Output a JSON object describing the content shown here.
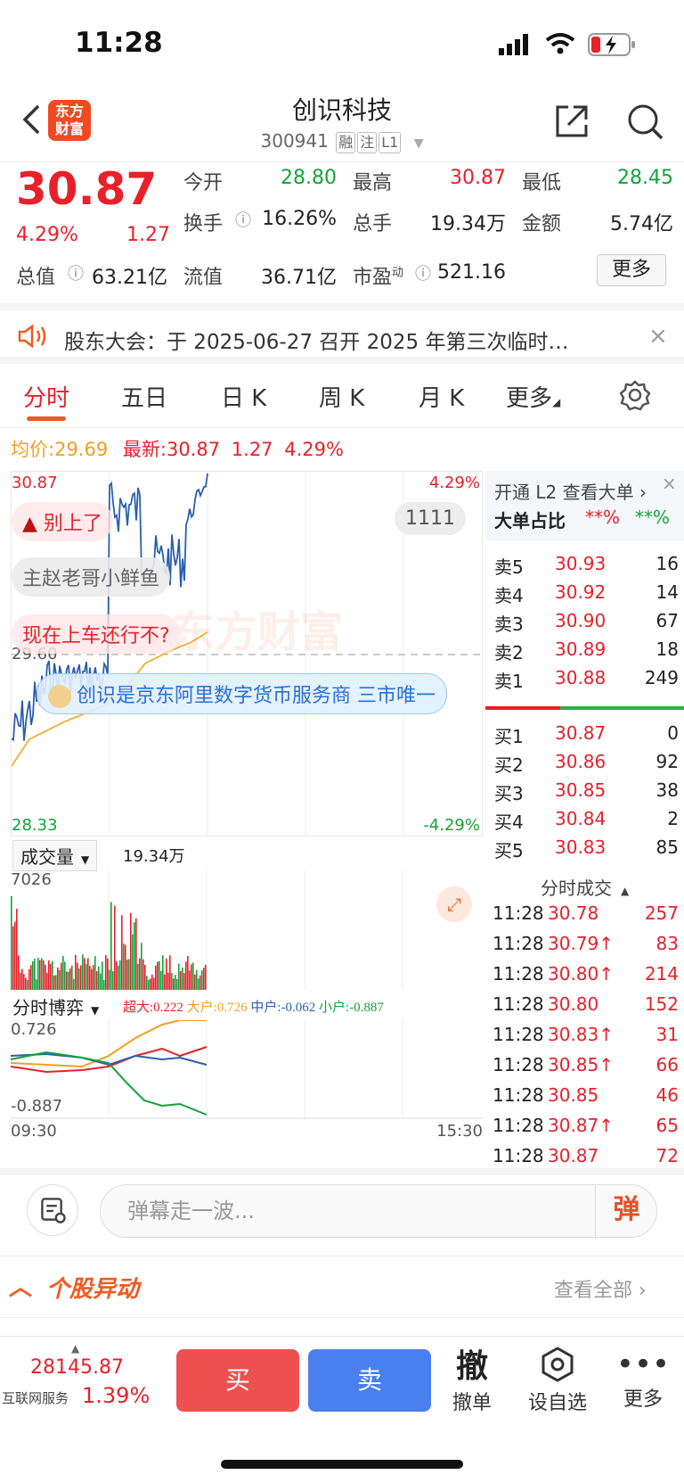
{
  "status_bar": {
    "time": "11:28"
  },
  "header": {
    "logo_line1": "东方",
    "logo_line2": "财富",
    "title": "创识科技",
    "code": "300941",
    "tags": [
      "融",
      "注",
      "L1"
    ]
  },
  "quote": {
    "price": "30.87",
    "change_pct": "4.29%",
    "change": "1.27",
    "fields": [
      {
        "label": "今开",
        "value": "28.80",
        "color": "#12a33a"
      },
      {
        "label": "最高",
        "value": "30.87",
        "color": "#e8202a"
      },
      {
        "label": "最低",
        "value": "28.45",
        "color": "#12a33a"
      },
      {
        "label": "换手",
        "value": "16.26%",
        "color": "#222222"
      },
      {
        "label": "总手",
        "value": "19.34万",
        "color": "#222222"
      },
      {
        "label": "金额",
        "value": "5.74亿",
        "color": "#222222"
      },
      {
        "label": "总值",
        "value": "63.21亿",
        "color": "#222222"
      },
      {
        "label": "流值",
        "value": "36.71亿",
        "color": "#222222"
      },
      {
        "label": "市盈",
        "sup": "动",
        "value": "521.16",
        "color": "#222222"
      }
    ],
    "more": "更多"
  },
  "notice": {
    "text": "股东大会：于 2025-06-27 召开 2025 年第三次临时…"
  },
  "tabs": [
    "分时",
    "五日",
    "日 K",
    "周 K",
    "月 K",
    "更多"
  ],
  "avg_line": {
    "avg_label": "均价:",
    "avg": "29.69",
    "latest_label": "最新:",
    "latest": "30.87",
    "change": "1.27",
    "pct": "4.29%"
  },
  "chart": {
    "y_high": "30.87",
    "y_mid": "29.60",
    "y_low": "28.33",
    "pct_high": "4.29%",
    "pct_low": "-4.29%",
    "danmu": [
      "别上了",
      "1111",
      "主赵老哥小鲜鱼",
      "现在上车还行不?",
      "创识是京东阿里数字货币服务商 三市唯一"
    ],
    "watermark": "东方财富"
  },
  "volume": {
    "label": "成交量",
    "total": "19.34万",
    "max": "7026"
  },
  "game": {
    "label": "分时博弈",
    "legend": [
      {
        "name": "超大:",
        "value": "0.222",
        "color": "#e8202a"
      },
      {
        "name": "大户:",
        "value": "0.726",
        "color": "#f0a020"
      },
      {
        "name": "中户:",
        "value": "-0.062",
        "color": "#2a5fb0"
      },
      {
        "name": "小户:",
        "value": "-0.887",
        "color": "#12a33a"
      }
    ],
    "y_high": "0.726",
    "y_low": "-0.887",
    "time_start": "09:30",
    "time_end": "15:30"
  },
  "book": {
    "l2_text": "开通 L2 查看大单 ›",
    "big_label": "大单占比",
    "big_buy": "**%",
    "big_sell": "**%",
    "sells": [
      {
        "label": "卖5",
        "price": "30.93",
        "vol": "16"
      },
      {
        "label": "卖4",
        "price": "30.92",
        "vol": "14"
      },
      {
        "label": "卖3",
        "price": "30.90",
        "vol": "67"
      },
      {
        "label": "卖2",
        "price": "30.89",
        "vol": "18"
      },
      {
        "label": "卖1",
        "price": "30.88",
        "vol": "249"
      }
    ],
    "buys": [
      {
        "label": "买1",
        "price": "30.87",
        "vol": "0"
      },
      {
        "label": "买2",
        "price": "30.86",
        "vol": "92"
      },
      {
        "label": "买3",
        "price": "30.85",
        "vol": "38"
      },
      {
        "label": "买4",
        "price": "30.84",
        "vol": "2"
      },
      {
        "label": "买5",
        "price": "30.83",
        "vol": "85"
      }
    ],
    "ticks_label": "分时成交",
    "ticks": [
      {
        "time": "11:28",
        "price": "30.78",
        "vol": "257"
      },
      {
        "time": "11:28",
        "price": "30.79↑",
        "vol": "83"
      },
      {
        "time": "11:28",
        "price": "30.80↑",
        "vol": "214"
      },
      {
        "time": "11:28",
        "price": "30.80",
        "vol": "152"
      },
      {
        "time": "11:28",
        "price": "30.83↑",
        "vol": "31"
      },
      {
        "time": "11:28",
        "price": "30.85↑",
        "vol": "66"
      },
      {
        "time": "11:28",
        "price": "30.85",
        "vol": "46"
      },
      {
        "time": "11:28",
        "price": "30.87↑",
        "vol": "65"
      },
      {
        "time": "11:28",
        "price": "30.87",
        "vol": "72"
      }
    ]
  },
  "input": {
    "placeholder": "弹幕走一波...",
    "send": "弹"
  },
  "anomaly": {
    "title": "个股异动",
    "view_all": "查看全部"
  },
  "bottom": {
    "index_value": "28145.87",
    "index_name": "互联网服务",
    "index_pct": "1.39%",
    "buy": "买",
    "sell": "卖",
    "cancel_glyph": "撤",
    "cancel": "撤单",
    "watch": "设自选",
    "more": "更多"
  }
}
